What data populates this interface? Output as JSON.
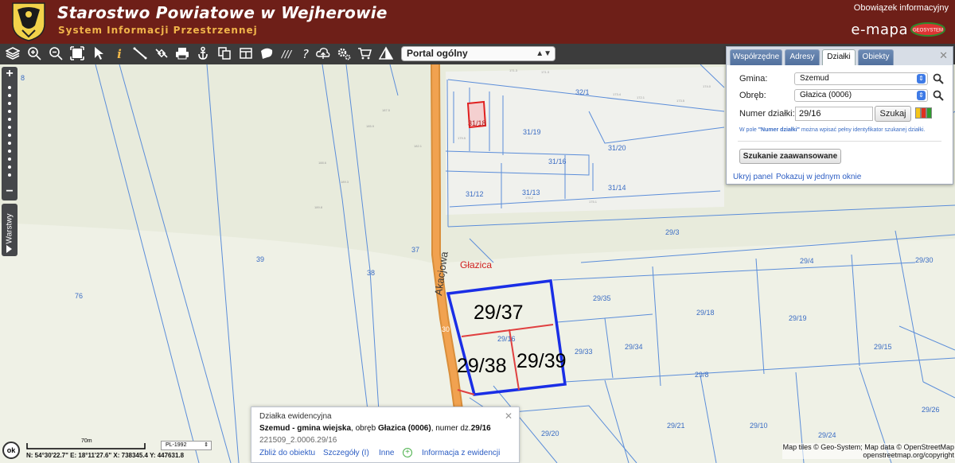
{
  "header": {
    "title": "Starostwo Powiatowe w Wejherowie",
    "subtitle": "System Informacji Przestrzennej",
    "info_link": "Obowiązek informacyjny",
    "emapa_text": "e-mapa",
    "emapa_logo_text": "GEOSYSTEM"
  },
  "toolbar": {
    "icons": [
      "layers-icon",
      "zoom-in-icon",
      "zoom-out-icon",
      "zoom-extent-icon",
      "select-arrow-icon",
      "info-icon",
      "measure-line-icon",
      "link-icon",
      "print-icon",
      "anchor-icon",
      "copy-icon",
      "layout-icon",
      "draw-shape-icon",
      "hatch-icon",
      "help-icon",
      "upload-cloud-icon",
      "settings-icon",
      "cart-icon",
      "triangle-icon"
    ],
    "help_glyph": "?",
    "hatch_glyph": "///",
    "portal_select": "Portal ogólny"
  },
  "map": {
    "labels": {
      "top_8": "8",
      "l_32_1": "32/1",
      "l_31_18": "31/18",
      "l_31_19": "31/19",
      "l_31_20": "31/20",
      "l_31_16": "31/16",
      "l_31_12": "31/12",
      "l_31_13": "31/13",
      "l_31_14": "31/14",
      "l_29_3": "29/3",
      "l_29_4": "29/4",
      "l_29_30": "29/30",
      "l_39": "39",
      "l_37": "37",
      "l_38": "38",
      "l_76": "76",
      "l_29_35": "29/35",
      "l_29_18": "29/18",
      "l_29_19": "29/19",
      "l_29_15": "29/15",
      "l_29_33": "29/33",
      "l_29_34": "29/34",
      "l_29_8": "29/8",
      "l_29_26": "29/26",
      "l_29_20": "29/20",
      "l_29_21": "29/21",
      "l_29_10": "29/10",
      "l_29_24": "29/24",
      "l_29_16": "29/16",
      "l_30": "30",
      "street": "Akacjowa",
      "village": "Głazica",
      "big_29_37": "29/37",
      "big_29_38": "29/38",
      "big_29_39": "29/39"
    }
  },
  "zoom": {
    "in": "+",
    "out": "−",
    "layers_tab": "Warstwy"
  },
  "panel": {
    "tabs": [
      "Współrzędne",
      "Adresy",
      "Działki",
      "Obiekty"
    ],
    "active_tab": "Działki",
    "gmina_label": "Gmina:",
    "gmina_value": "Szemud",
    "obreb_label": "Obręb:",
    "obreb_value": "Głazica (0006)",
    "numer_label": "Numer działki:",
    "numer_value": "29/16",
    "szukaj": "Szukaj",
    "hint_prefix": "W pole ",
    "hint_bold": "\"Numer działki\"",
    "hint_suffix": " można wpisać pełny identyfikator szukanej działki.",
    "advanced_button": "Szukanie zaawansowane",
    "hide_link": "Ukryj panel",
    "one_window_link": "Pokazuj w jednym oknie",
    "swatch_colors": [
      "#f5c518",
      "#e03020",
      "#2f9b2f"
    ]
  },
  "popup": {
    "title": "Działka ewidencyjna",
    "gmina": "Szemud - gmina wiejska",
    "obreb_prefix": ", obręb ",
    "obreb": "Głazica (0006)",
    "numer_prefix": ", numer dz.",
    "numer": "29/16",
    "identifier": "221509_2.0006.29/16",
    "zoom_link": "Zbliż do obiektu",
    "details_link": "Szczegóły (I)",
    "other_link": "Inne",
    "registry_link": "Informacja z ewidencji"
  },
  "status": {
    "ok": "ok",
    "scale": "70m",
    "crs": "PL-1992",
    "coords": "N: 54°30'22.7\"  E: 18°11'27.6\"  X: 738345.4  Y: 447631.8",
    "attribution_1": "Map tiles © Geo-System; Map data © OpenStreetMap",
    "attribution_2": "openstreetmap.org/copyright"
  }
}
